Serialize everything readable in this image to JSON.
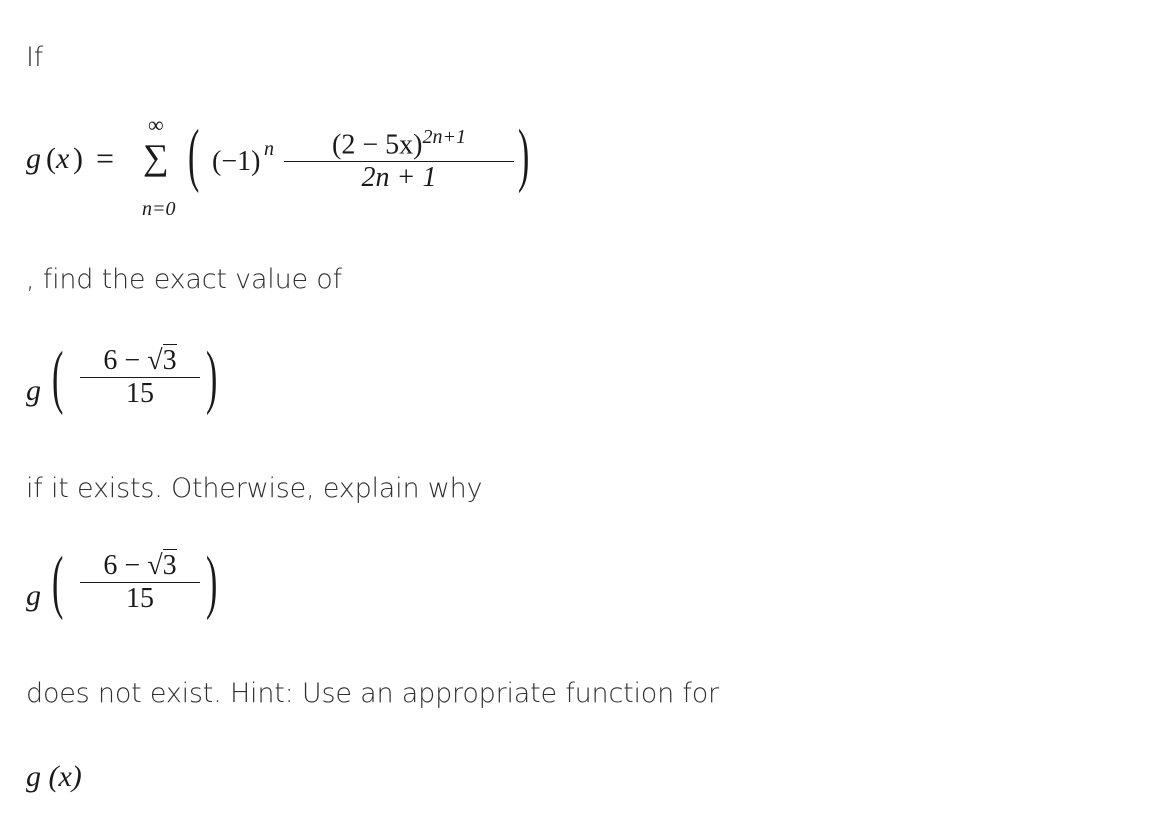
{
  "text": {
    "intro": "If",
    "find": ", find the exact value of",
    "if_exists": "if it exists.  Otherwise, explain why",
    "does_not_exist": "does not exist.  Hint: Use an appropriate function for"
  },
  "series": {
    "func_name": "g",
    "var": "x",
    "equals": "=",
    "sum_upper": "∞",
    "sum_symbol": "∑",
    "sum_lower": "n=0",
    "sign_base": "(−1)",
    "sign_exp": "n",
    "numerator_base": "(2 − 5x)",
    "numerator_exp": "2n+1",
    "denominator": "2n + 1"
  },
  "argument": {
    "func_name": "g",
    "numerator_lead": "6 − ",
    "radical": "3",
    "denominator": "15"
  },
  "final_expr": "g (x)"
}
